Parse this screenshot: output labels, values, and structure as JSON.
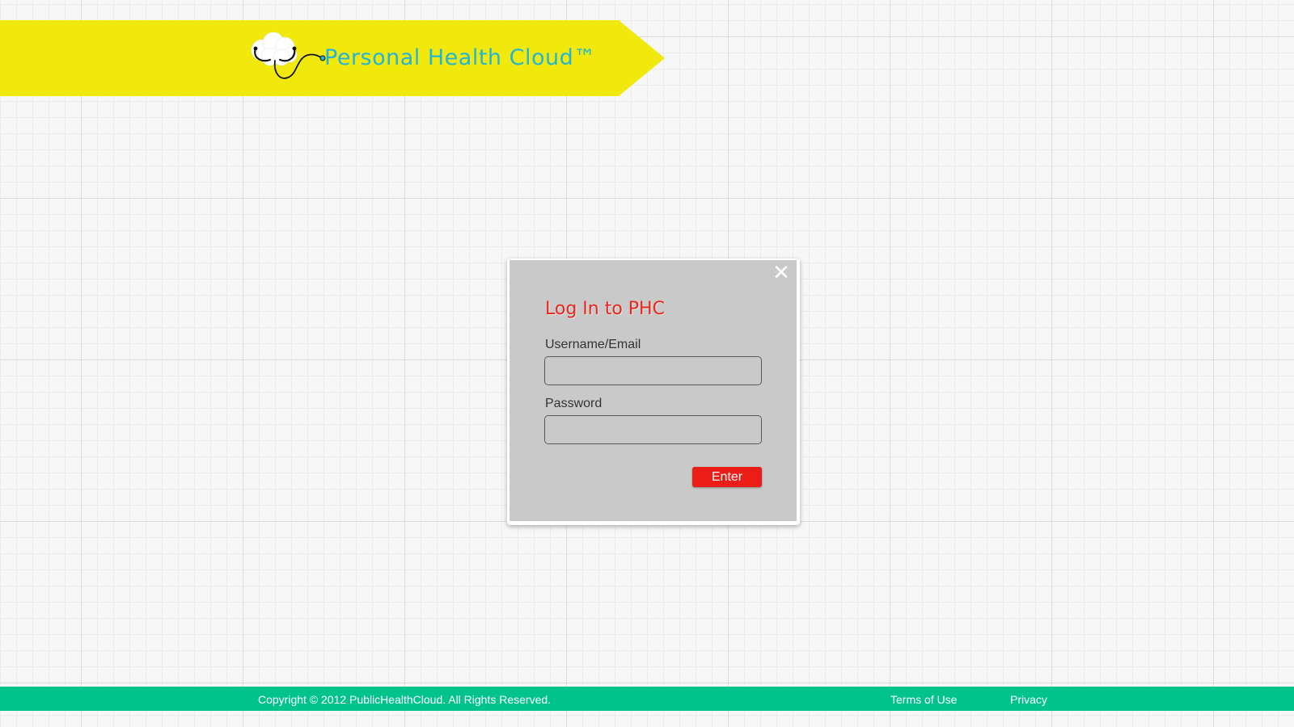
{
  "header": {
    "brand": "Personal Health Cloud™",
    "logo_icon": "cloud-stethoscope-icon",
    "banner_color": "#f2e90c",
    "brand_color": "#22b5d6"
  },
  "login_modal": {
    "title": "Log In to PHC",
    "close_icon": "close-icon",
    "username_label": "Username/Email",
    "username_value": "",
    "password_label": "Password",
    "password_value": "",
    "enter_label": "Enter",
    "accent_color": "#ea1d17"
  },
  "footer": {
    "copyright": "Copyright © 2012 PublicHealthCloud. All Rights Reserved.",
    "terms_label": "Terms of Use",
    "privacy_label": "Privacy",
    "background_color": "#00c28b"
  }
}
